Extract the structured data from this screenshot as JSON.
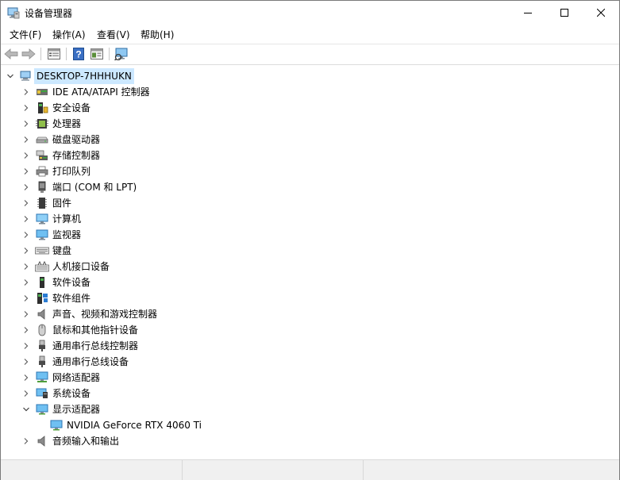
{
  "window": {
    "title": "设备管理器"
  },
  "menu": [
    {
      "label": "文件(F)"
    },
    {
      "label": "操作(A)"
    },
    {
      "label": "查看(V)"
    },
    {
      "label": "帮助(H)"
    }
  ],
  "toolbar": {
    "icons": [
      "back-arrow-icon",
      "forward-arrow-icon",
      "properties-icon",
      "help-icon",
      "view-resources-icon",
      "scan-hardware-icon"
    ]
  },
  "tree": {
    "root": {
      "label": "DESKTOP-7HHHUKN",
      "expanded": true
    },
    "categories": [
      {
        "label": "IDE ATA/ATAPI 控制器",
        "icon": "ide-controller-icon",
        "expanded": false
      },
      {
        "label": "安全设备",
        "icon": "security-device-icon",
        "expanded": false
      },
      {
        "label": "处理器",
        "icon": "processor-icon",
        "expanded": false
      },
      {
        "label": "磁盘驱动器",
        "icon": "disk-drive-icon",
        "expanded": false
      },
      {
        "label": "存储控制器",
        "icon": "storage-controller-icon",
        "expanded": false
      },
      {
        "label": "打印队列",
        "icon": "printer-icon",
        "expanded": false
      },
      {
        "label": "端口 (COM 和 LPT)",
        "icon": "port-icon",
        "expanded": false
      },
      {
        "label": "固件",
        "icon": "firmware-icon",
        "expanded": false
      },
      {
        "label": "计算机",
        "icon": "computer-icon",
        "expanded": false
      },
      {
        "label": "监视器",
        "icon": "monitor-icon",
        "expanded": false
      },
      {
        "label": "键盘",
        "icon": "keyboard-icon",
        "expanded": false
      },
      {
        "label": "人机接口设备",
        "icon": "hid-icon",
        "expanded": false
      },
      {
        "label": "软件设备",
        "icon": "software-device-icon",
        "expanded": false
      },
      {
        "label": "软件组件",
        "icon": "software-component-icon",
        "expanded": false
      },
      {
        "label": "声音、视频和游戏控制器",
        "icon": "speaker-icon",
        "expanded": false
      },
      {
        "label": "鼠标和其他指针设备",
        "icon": "mouse-icon",
        "expanded": false
      },
      {
        "label": "通用串行总线控制器",
        "icon": "usb-icon",
        "expanded": false
      },
      {
        "label": "通用串行总线设备",
        "icon": "usb-device-icon",
        "expanded": false
      },
      {
        "label": "网络适配器",
        "icon": "network-adapter-icon",
        "expanded": false
      },
      {
        "label": "系统设备",
        "icon": "system-device-icon",
        "expanded": false
      },
      {
        "label": "显示适配器",
        "icon": "display-adapter-icon",
        "expanded": true,
        "children": [
          {
            "label": "NVIDIA GeForce RTX 4060 Ti",
            "icon": "display-adapter-icon"
          }
        ]
      },
      {
        "label": "音频输入和输出",
        "icon": "audio-io-icon",
        "expanded": false
      }
    ]
  },
  "colors": {
    "selection": "#cce8ff",
    "chevron": "#606060",
    "accent": "#2b7cd3"
  }
}
